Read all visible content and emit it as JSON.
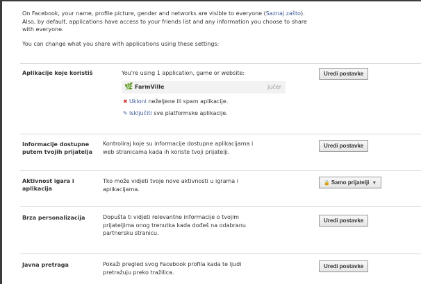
{
  "intro": {
    "text1": "On Facebook, your name, profile picture, gender and networks are visible to everyone (",
    "learn_more": "Saznaj zašto",
    "text2": "). Also, by default, applications have access to your friends list and any information you choose to share with everyone.",
    "change_text": "You can change what you share with applications using these settings:"
  },
  "sections": {
    "apps": {
      "label": "Aplikacije koje koristiš",
      "desc": "You're using 1 application, game or website:",
      "button": "Uredi postavke",
      "app_name": "FarmVille",
      "app_date": "jučer",
      "app_icon": "farmville-icon",
      "remove_link": "Ukloni",
      "remove_text": " neželjene ili spam aplikacije.",
      "disable_link": "Isključiti",
      "disable_text": " sve platformske aplikacije."
    },
    "friends_info": {
      "label_line1": "Informacije dostupne",
      "label_line2": "putem tvojih prijatelja",
      "desc_line1": "Kontroliraj koje su informacije dostupne aplikacijama i",
      "desc_line2": "web stranicama kada ih koriste tvoji prijatelji.",
      "button": "Uredi postavke"
    },
    "game_activity": {
      "label_line1": "Aktivnost igara i",
      "label_line2": "aplikacija",
      "desc_line1": "Tko može vidjeti tvoje nove aktivnosti u igrama i",
      "desc_line2": "aplikacijama.",
      "dropdown_value": "Samo prijatelji",
      "lock_icon": "lock-icon"
    },
    "personalization": {
      "label": "Brza personalizacija",
      "desc_line1": "Dopušta ti vidjeti relevantne informacije o tvojim",
      "desc_line2": "prijateljima onog trenutka kada dođeš na odabranu",
      "desc_line3": "partnersku stranicu.",
      "button": "Uredi postavke"
    },
    "public_search": {
      "label": "Javna pretraga",
      "desc_line1": "Pokaži pregled svog Facebook profila kada te ljudi",
      "desc_line2": "pretražuju preko tražilica.",
      "button": "Uredi postavke"
    }
  }
}
